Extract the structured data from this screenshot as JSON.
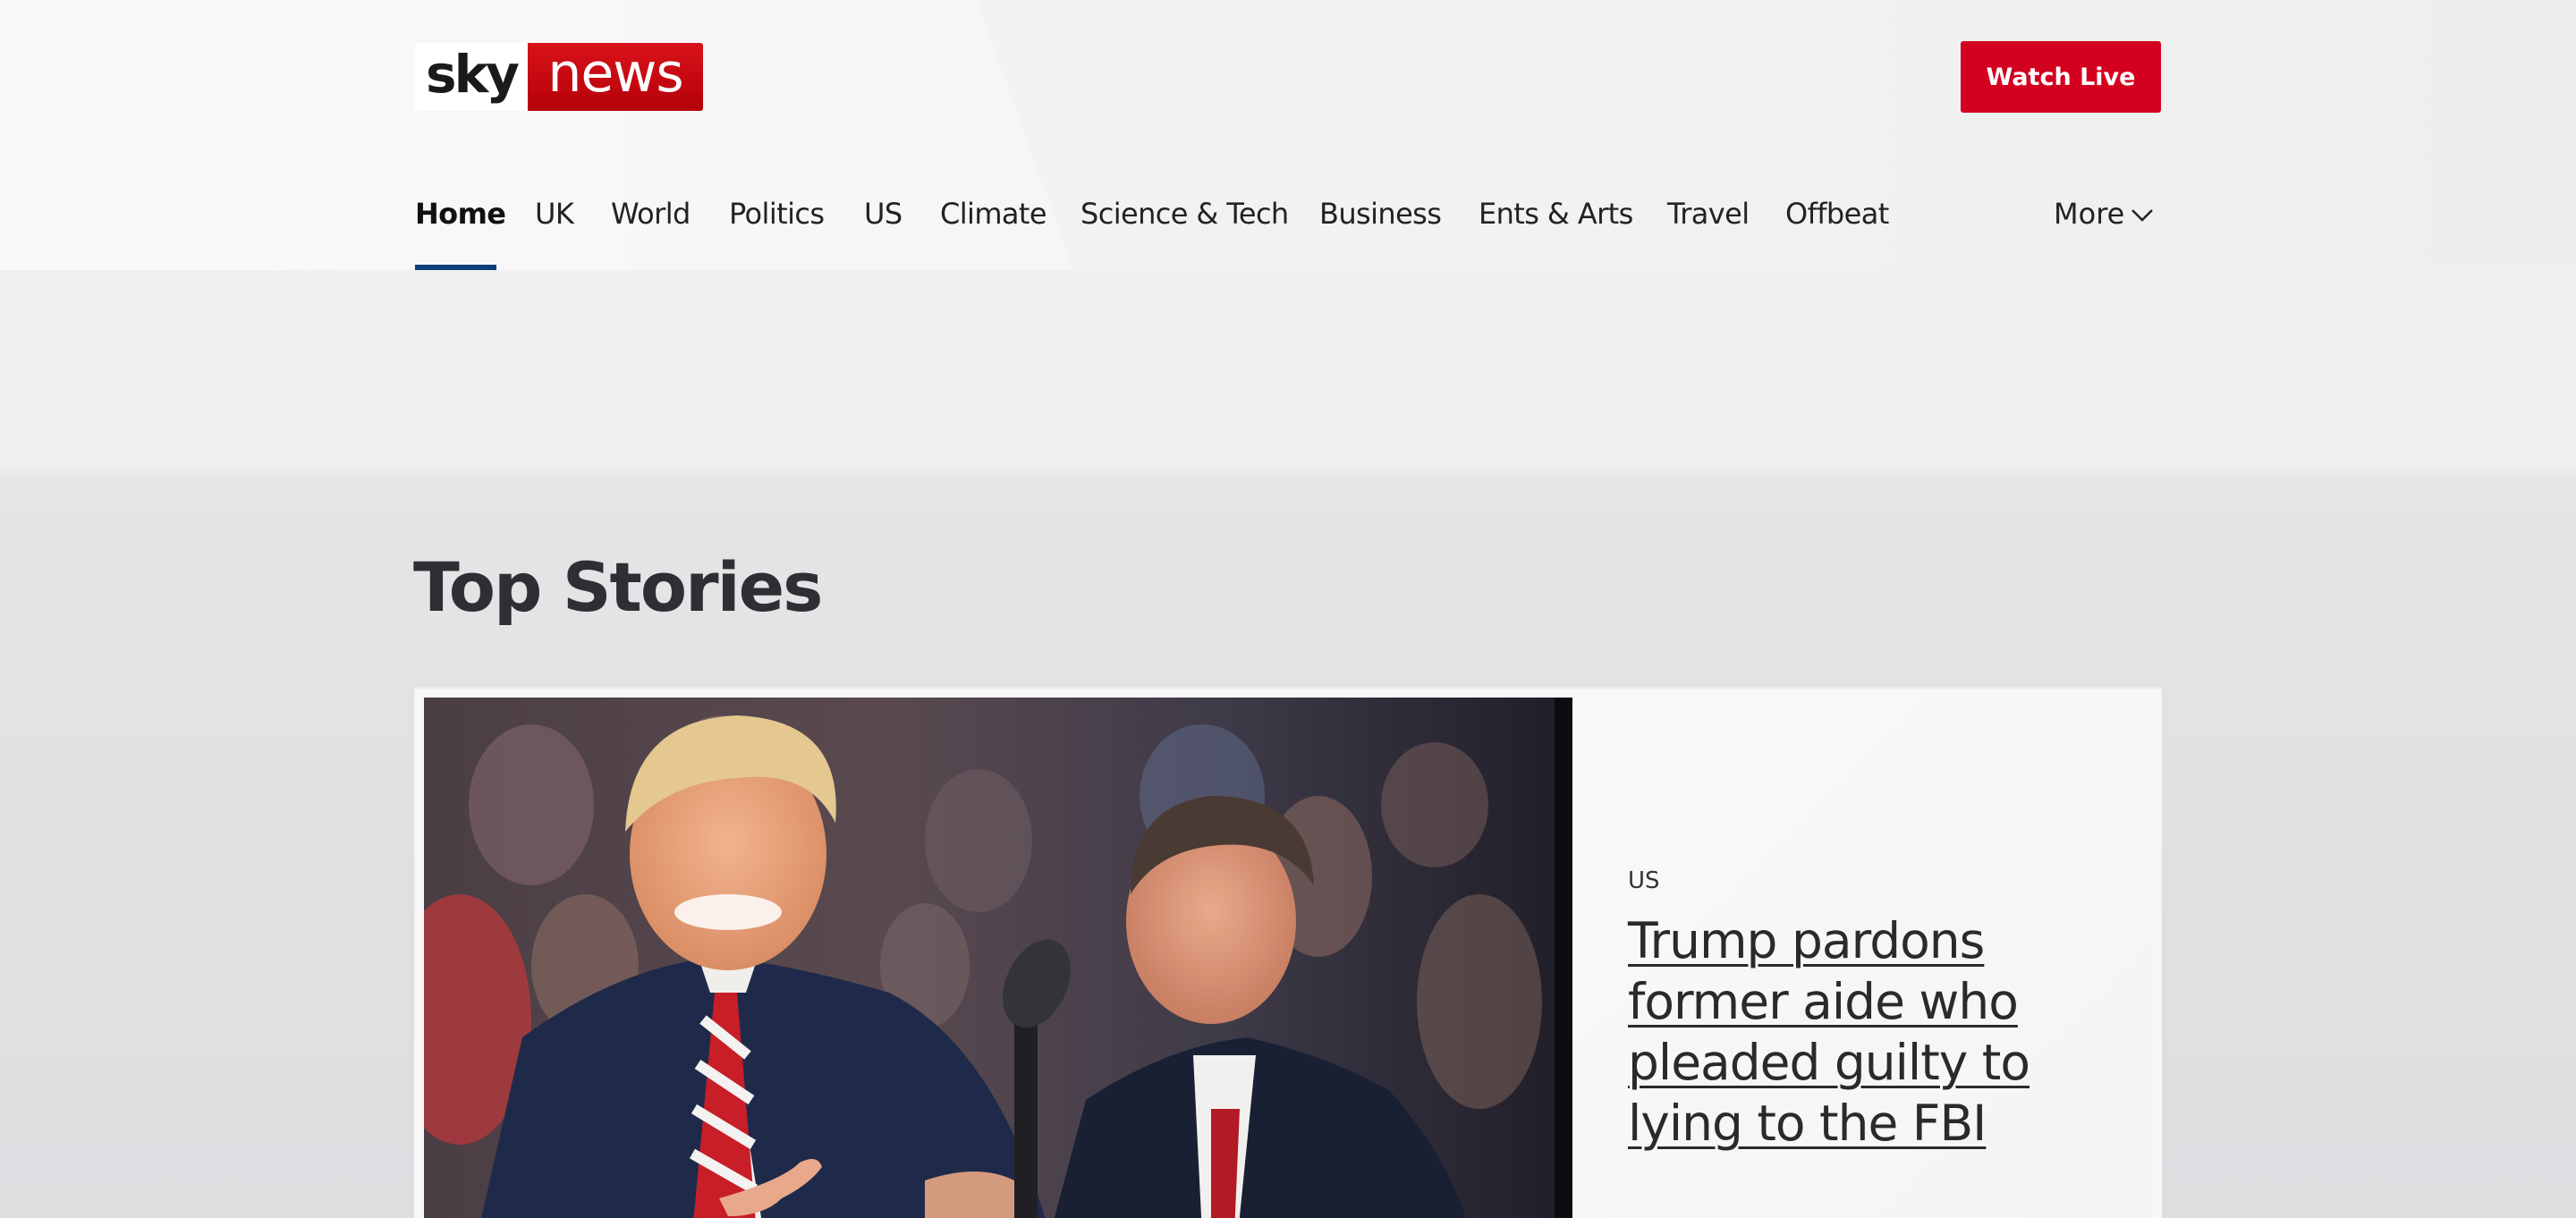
{
  "header": {
    "logo": {
      "sky": "sky",
      "news": "news"
    },
    "watch_live_label": "Watch Live"
  },
  "nav": {
    "items": [
      {
        "label": "Home",
        "active": true
      },
      {
        "label": "UK",
        "active": false
      },
      {
        "label": "World",
        "active": false
      },
      {
        "label": "Politics",
        "active": false
      },
      {
        "label": "US",
        "active": false
      },
      {
        "label": "Climate",
        "active": false
      },
      {
        "label": "Science & Tech",
        "active": false
      },
      {
        "label": "Business",
        "active": false
      },
      {
        "label": "Ents & Arts",
        "active": false
      },
      {
        "label": "Travel",
        "active": false
      },
      {
        "label": "Offbeat",
        "active": false
      }
    ],
    "more_label": "More",
    "more_icon": "chevron-down-icon"
  },
  "top_stories": {
    "title": "Top Stories",
    "lead_story": {
      "category": "US",
      "headline": "Trump pardons former aide who pleaded guilty to lying to the FBI"
    }
  },
  "colors": {
    "brand_red": "#d4001f",
    "nav_underline": "#0f3d7a"
  }
}
